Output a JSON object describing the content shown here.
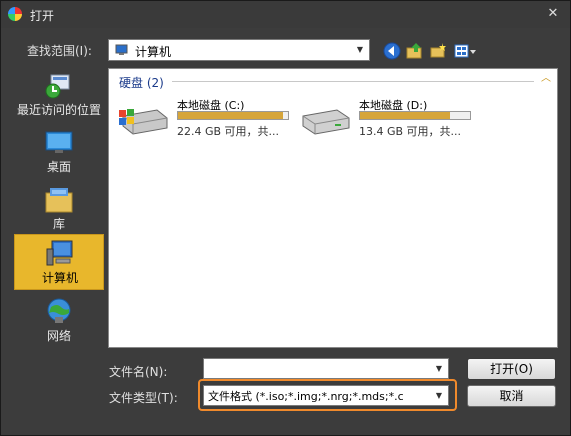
{
  "window": {
    "title": "打开",
    "close_glyph": "✕"
  },
  "lookin": {
    "label": "查找范围(I):",
    "value": "计算机",
    "icon": "computer-icon"
  },
  "toolbar": {
    "buttons": [
      {
        "name": "back-button",
        "icon": "back-arrow-icon"
      },
      {
        "name": "up-folder-button",
        "icon": "up-folder-icon"
      },
      {
        "name": "new-folder-button",
        "icon": "new-folder-icon"
      },
      {
        "name": "view-menu-button",
        "icon": "view-menu-icon"
      }
    ]
  },
  "places": [
    {
      "label": "最近访问的位置",
      "icon": "recent-places-icon",
      "active": false
    },
    {
      "label": "桌面",
      "icon": "desktop-icon",
      "active": false
    },
    {
      "label": "库",
      "icon": "libraries-icon",
      "active": false
    },
    {
      "label": "计算机",
      "icon": "computer-icon",
      "active": true
    },
    {
      "label": "网络",
      "icon": "network-icon",
      "active": false
    }
  ],
  "group": {
    "header": "硬盘 (2)"
  },
  "drives": [
    {
      "name": "本地磁盘 (C:)",
      "info": "22.4 GB 可用，共...",
      "used_fraction": 0.95,
      "icon": "windows-drive-icon"
    },
    {
      "name": "本地磁盘 (D:)",
      "info": "13.4 GB 可用，共...",
      "used_fraction": 0.82,
      "icon": "hard-drive-icon"
    }
  ],
  "filename": {
    "label": "文件名(N):",
    "value": ""
  },
  "filetype": {
    "label": "文件类型(T):",
    "value": "文件格式 (*.iso;*.img;*.nrg;*.mds;*.c"
  },
  "buttons": {
    "open": "打开(O)",
    "cancel": "取消"
  },
  "colors": {
    "accent": "#e8b72c",
    "highlight": "#f08a2c",
    "bar_fill": "#d6a53a"
  }
}
